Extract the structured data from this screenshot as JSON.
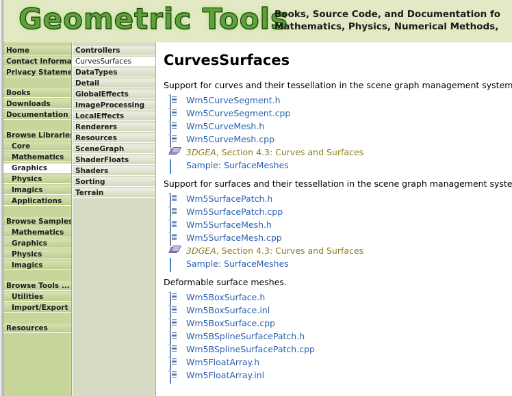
{
  "header": {
    "logo": "Geometric Tools",
    "tagline_line1": "Books, Source Code, and Documentation fo",
    "tagline_line2": "Mathematics, Physics, Numerical Methods,",
    "logo_color": "#5fa03c",
    "background": "#e3e9c5"
  },
  "sidebar_primary": {
    "items": [
      {
        "label": "Home",
        "indent": false,
        "selected": false,
        "spacer": false
      },
      {
        "label": "Contact Information",
        "indent": false,
        "selected": false,
        "spacer": false
      },
      {
        "label": "Privacy Statement",
        "indent": false,
        "selected": false,
        "spacer": false
      },
      {
        "label": "",
        "indent": false,
        "selected": false,
        "spacer": true
      },
      {
        "label": "Books",
        "indent": false,
        "selected": false,
        "spacer": false
      },
      {
        "label": "Downloads",
        "indent": false,
        "selected": false,
        "spacer": false
      },
      {
        "label": "Documentation",
        "indent": false,
        "selected": false,
        "spacer": false
      },
      {
        "label": "",
        "indent": false,
        "selected": false,
        "spacer": true
      },
      {
        "label": "Browse Libraries ...",
        "indent": false,
        "selected": false,
        "spacer": false
      },
      {
        "label": "Core",
        "indent": true,
        "selected": false,
        "spacer": false
      },
      {
        "label": "Mathematics",
        "indent": true,
        "selected": false,
        "spacer": false
      },
      {
        "label": "Graphics",
        "indent": true,
        "selected": true,
        "spacer": false
      },
      {
        "label": "Physics",
        "indent": true,
        "selected": false,
        "spacer": false
      },
      {
        "label": "Imagics",
        "indent": true,
        "selected": false,
        "spacer": false
      },
      {
        "label": "Applications",
        "indent": true,
        "selected": false,
        "spacer": false
      },
      {
        "label": "",
        "indent": false,
        "selected": false,
        "spacer": true
      },
      {
        "label": "Browse Samples ...",
        "indent": false,
        "selected": false,
        "spacer": false
      },
      {
        "label": "Mathematics",
        "indent": true,
        "selected": false,
        "spacer": false
      },
      {
        "label": "Graphics",
        "indent": true,
        "selected": false,
        "spacer": false
      },
      {
        "label": "Physics",
        "indent": true,
        "selected": false,
        "spacer": false
      },
      {
        "label": "Imagics",
        "indent": true,
        "selected": false,
        "spacer": false
      },
      {
        "label": "",
        "indent": false,
        "selected": false,
        "spacer": true
      },
      {
        "label": "Browse Tools ...",
        "indent": false,
        "selected": false,
        "spacer": false
      },
      {
        "label": "Utilities",
        "indent": true,
        "selected": false,
        "spacer": false
      },
      {
        "label": "Import/Export",
        "indent": true,
        "selected": false,
        "spacer": false
      },
      {
        "label": "",
        "indent": false,
        "selected": false,
        "spacer": true
      },
      {
        "label": "Resources",
        "indent": false,
        "selected": false,
        "spacer": false
      }
    ]
  },
  "sidebar_secondary": {
    "items": [
      {
        "label": "Controllers",
        "selected": false
      },
      {
        "label": "CurvesSurfaces",
        "selected": true
      },
      {
        "label": "DataTypes",
        "selected": false
      },
      {
        "label": "Detail",
        "selected": false
      },
      {
        "label": "GlobalEffects",
        "selected": false
      },
      {
        "label": "ImageProcessing",
        "selected": false
      },
      {
        "label": "LocalEffects",
        "selected": false
      },
      {
        "label": "Renderers",
        "selected": false
      },
      {
        "label": "Resources",
        "selected": false
      },
      {
        "label": "SceneGraph",
        "selected": false
      },
      {
        "label": "ShaderFloats",
        "selected": false
      },
      {
        "label": "Shaders",
        "selected": false
      },
      {
        "label": "Sorting",
        "selected": false
      },
      {
        "label": "Terrain",
        "selected": false
      }
    ]
  },
  "main": {
    "title": "CurvesSurfaces",
    "sections": [
      {
        "description": "Support for curves and their tessellation in the scene graph management system.",
        "links": [
          {
            "icon": "file-icon",
            "text": "Wm5CurveSegment.h",
            "kind": "code"
          },
          {
            "icon": "file-icon",
            "text": "Wm5CurveSegment.cpp",
            "kind": "code"
          },
          {
            "icon": "file-icon",
            "text": "Wm5CurveMesh.h",
            "kind": "code"
          },
          {
            "icon": "file-icon",
            "text": "Wm5CurveMesh.cpp",
            "kind": "code"
          },
          {
            "icon": "book-icon",
            "text": "3DGEA, Section 4.3: Curves and Surfaces",
            "kind": "reference",
            "ref_title": "3DGEA",
            "ref_rest": ", Section 4.3: Curves and Surfaces"
          },
          {
            "icon": "window-icon",
            "text": "Sample: SurfaceMeshes",
            "kind": "sample"
          }
        ]
      },
      {
        "description": "Support for surfaces and their tessellation in the scene graph management system.",
        "links": [
          {
            "icon": "file-icon",
            "text": "Wm5SurfacePatch.h",
            "kind": "code"
          },
          {
            "icon": "file-icon",
            "text": "Wm5SurfacePatch.cpp",
            "kind": "code"
          },
          {
            "icon": "file-icon",
            "text": "Wm5SurfaceMesh.h",
            "kind": "code"
          },
          {
            "icon": "file-icon",
            "text": "Wm5SurfaceMesh.cpp",
            "kind": "code"
          },
          {
            "icon": "book-icon",
            "text": "3DGEA, Section 4.3: Curves and Surfaces",
            "kind": "reference",
            "ref_title": "3DGEA",
            "ref_rest": ", Section 4.3: Curves and Surfaces"
          },
          {
            "icon": "window-icon",
            "text": "Sample: SurfaceMeshes",
            "kind": "sample"
          }
        ]
      },
      {
        "description": "Deformable surface meshes.",
        "links": [
          {
            "icon": "file-icon",
            "text": "Wm5BoxSurface.h",
            "kind": "code"
          },
          {
            "icon": "file-icon",
            "text": "Wm5BoxSurface.inl",
            "kind": "code"
          },
          {
            "icon": "file-icon",
            "text": "Wm5BoxSurface.cpp",
            "kind": "code"
          },
          {
            "icon": "file-icon",
            "text": "Wm5BSplineSurfacePatch.h",
            "kind": "code"
          },
          {
            "icon": "file-icon",
            "text": "Wm5BSplineSurfacePatch.cpp",
            "kind": "code"
          },
          {
            "icon": "file-icon",
            "text": "Wm5FloatArray.h",
            "kind": "code"
          },
          {
            "icon": "file-icon",
            "text": "Wm5FloatArray.inl",
            "kind": "code"
          }
        ]
      }
    ]
  },
  "colors": {
    "link": "#2a60b0",
    "reference": "#8a7d1e",
    "sidebar_primary_bg": "#c7d69a",
    "sidebar_secondary_bg": "#d6dcc4"
  }
}
